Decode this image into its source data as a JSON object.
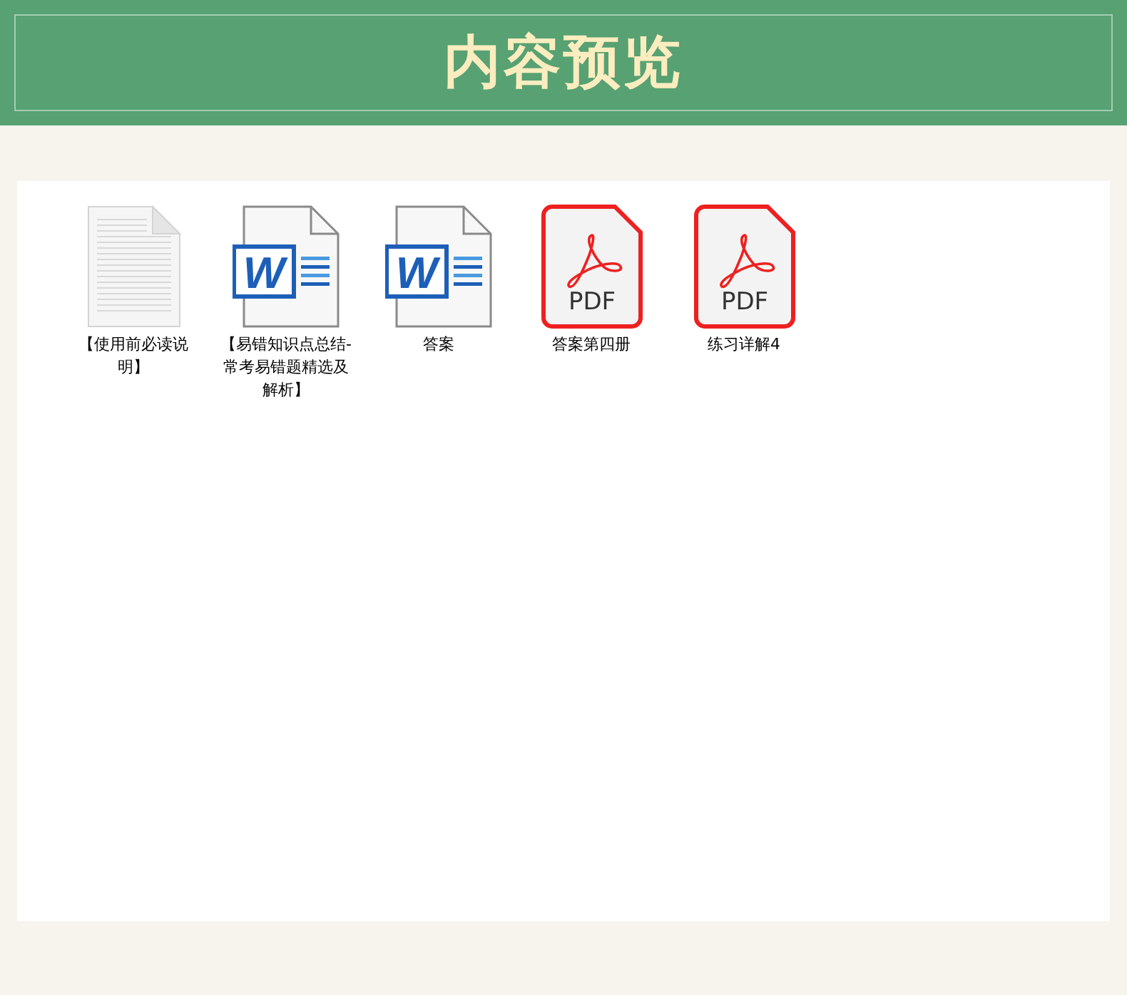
{
  "header": {
    "title": "内容预览"
  },
  "files": [
    {
      "kind": "text",
      "name": "【使用前必读说明】"
    },
    {
      "kind": "word",
      "icon_text": "W",
      "name": "【易错知识点总结-常考易错题精选及解析】"
    },
    {
      "kind": "word",
      "icon_text": "W",
      "name": "答案"
    },
    {
      "kind": "pdf",
      "icon_text": "PDF",
      "name": "答案第四册"
    },
    {
      "kind": "pdf",
      "icon_text": "PDF",
      "name": "练习详解4"
    }
  ]
}
